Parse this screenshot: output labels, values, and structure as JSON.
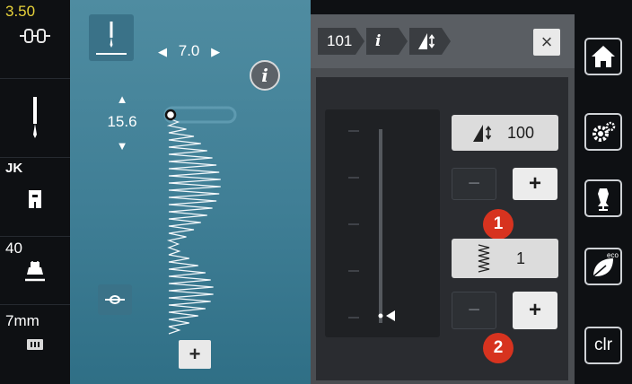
{
  "left_sidebar": {
    "tension": "3.50",
    "presser_foot_code": "JK",
    "pressure": "40",
    "stitch_plate": "7mm"
  },
  "center": {
    "stitch_width": "7.0",
    "stitch_length": "15.6",
    "plus_label": "+"
  },
  "panel": {
    "breadcrumb_stitch": "101",
    "breadcrumb_info": "i",
    "close_label": "×",
    "balance_value": "100",
    "pattern_repeat_value": "1",
    "minus_label": "−",
    "plus_label": "+",
    "badge_1": "1",
    "badge_2": "2"
  },
  "right_sidebar": {
    "clr_label": "clr",
    "eco_label": "eco"
  },
  "colors": {
    "stitch_area": "#3f7e95",
    "badge": "#d7331f",
    "tension_text": "#e7d23a"
  }
}
